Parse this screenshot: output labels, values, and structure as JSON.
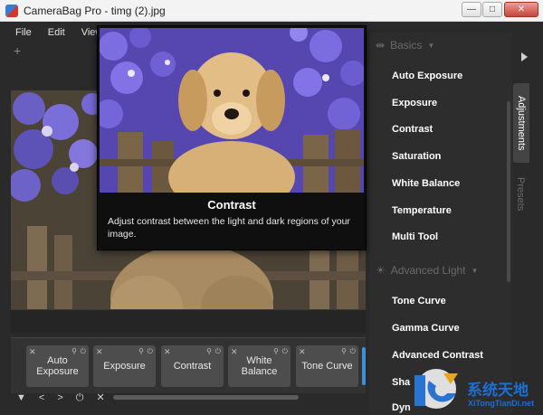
{
  "window": {
    "title": "CameraBag Pro - timg (2).jpg",
    "controls": {
      "minimize": "—",
      "maximize": "□",
      "close": "✕"
    }
  },
  "menu": [
    "File",
    "Edit",
    "View"
  ],
  "toolbar": {
    "add_label": "+"
  },
  "tooltip": {
    "title": "Contrast",
    "description": "Adjust contrast between the light and dark regions of your image."
  },
  "right_panel": {
    "sections": [
      {
        "title": "Basics",
        "icon": "sliders-icon"
      },
      {
        "title": "Advanced Light",
        "icon": "sun-icon"
      }
    ],
    "basics_items": [
      "Auto Exposure",
      "Exposure",
      "Contrast",
      "Saturation",
      "White Balance",
      "Temperature",
      "Multi Tool"
    ],
    "advanced_items": [
      "Tone Curve",
      "Gamma Curve",
      "Advanced Contrast"
    ],
    "partial_items": [
      "Sha",
      "Dyn"
    ],
    "tabs": [
      "Adjustments",
      "Presets"
    ]
  },
  "tool_strip": {
    "tiles": [
      "Auto\nExposure",
      "Exposure",
      "Contrast",
      "White\nBalance",
      "Tone Curve"
    ],
    "tile_icons": {
      "close": "✕",
      "pin": "📌",
      "power": "⏻"
    },
    "controls": [
      "▼",
      "<",
      ">",
      "⏻",
      "✕"
    ]
  },
  "watermark": {
    "title": "系统天地",
    "url": "XiTongTianDi.net"
  },
  "colors": {
    "accent": "#3d8fd6",
    "panel_bg": "#2d2d2d",
    "app_bg": "#2a2a2a"
  }
}
